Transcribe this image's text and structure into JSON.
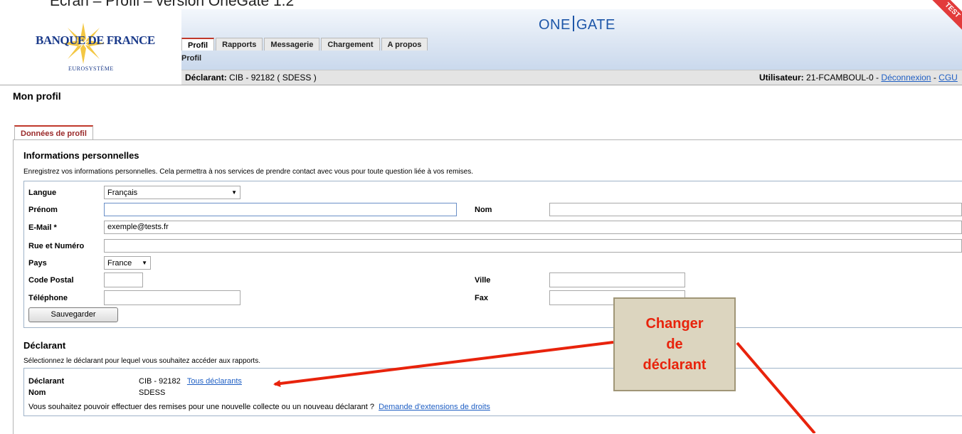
{
  "slide_title": "Ecran – Profil – version OneGate 1.2",
  "logo": {
    "name": "BANQUE DE FRANCE",
    "sub": "EUROSYSTÈME"
  },
  "brand": {
    "left": "ONE",
    "right": "GATE"
  },
  "test_ribbon": "TEST",
  "nav": {
    "tabs": [
      {
        "label": "Profil",
        "active": true
      },
      {
        "label": "Rapports",
        "active": false
      },
      {
        "label": "Messagerie",
        "active": false
      },
      {
        "label": "Chargement",
        "active": false
      },
      {
        "label": "A propos",
        "active": false
      }
    ],
    "subnav": "Profil"
  },
  "infobar": {
    "declarant_label": "Déclarant:",
    "declarant_value": "CIB - 92182 ( SDESS )",
    "user_label": "Utilisateur:",
    "user_value": "21-FCAMBOUL-0 -",
    "logout": "Déconnexion",
    "dash": "-",
    "cgu": "CGU"
  },
  "page_title": "Mon profil",
  "profile_tab": "Données de profil",
  "personal": {
    "heading": "Informations personnelles",
    "description": "Enregistrez vos informations personnelles. Cela permettra à nos services de prendre contact avec vous pour toute question liée à vos remises.",
    "fields": {
      "langue": {
        "label": "Langue",
        "value": "Français"
      },
      "prenom": {
        "label": "Prénom",
        "value": ""
      },
      "nom": {
        "label": "Nom",
        "value": ""
      },
      "email": {
        "label": "E-Mail *",
        "value": "exemple@tests.fr"
      },
      "rue": {
        "label": "Rue et Numéro",
        "value": ""
      },
      "pays": {
        "label": "Pays",
        "value": "France"
      },
      "code_postal": {
        "label": "Code Postal",
        "value": ""
      },
      "ville": {
        "label": "Ville",
        "value": ""
      },
      "telephone": {
        "label": "Téléphone",
        "value": ""
      },
      "fax": {
        "label": "Fax",
        "value": ""
      }
    },
    "save_label": "Sauvegarder"
  },
  "declarant_section": {
    "heading": "Déclarant",
    "description": "Sélectionnez le déclarant pour lequel vous souhaitez accéder aux rapports.",
    "declarant_label": "Déclarant",
    "declarant_value": "CIB - 92182",
    "all_link": "Tous déclarants",
    "nom_label": "Nom",
    "nom_value": "SDESS",
    "question": "Vous souhaitez pouvoir effectuer des remises pour une nouvelle collecte ou un nouveau déclarant ?",
    "extension_link": "Demande d'extensions de droits"
  },
  "callout": {
    "line1": "Changer",
    "line2": "de",
    "line3": "déclarant"
  },
  "colors": {
    "accent": "#c0392b",
    "link": "#1f5fc4",
    "brand": "#1d56a8",
    "callout_text": "#e8230c",
    "callout_bg": "#dcd5bf"
  }
}
